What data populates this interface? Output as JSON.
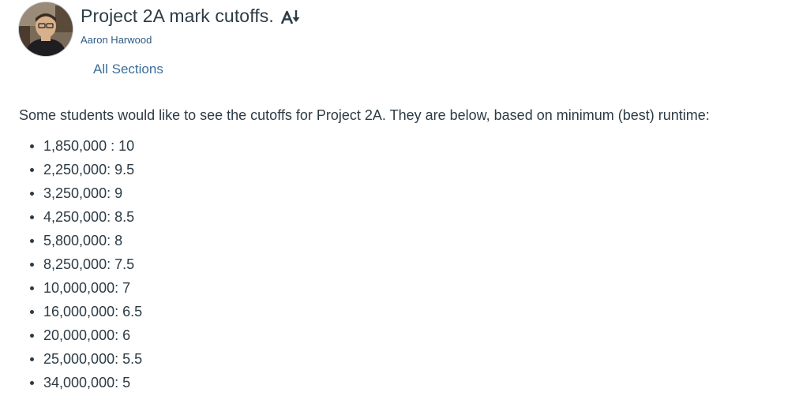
{
  "topic": {
    "title": "Project 2A mark cutoffs.",
    "translate_icon": "text-translate-icon",
    "author": "Aaron Harwood",
    "sections": "All Sections"
  },
  "message": {
    "intro": "Some students would like to see the cutoffs for Project 2A. They are below, based on minimum (best) runtime:",
    "cutoffs": [
      "1,850,000 : 10",
      "2,250,000: 9.5",
      "3,250,000: 9",
      "4,250,000: 8.5",
      "5,800,000: 8",
      "8,250,000: 7.5",
      "10,000,000: 7",
      "16,000,000: 6.5",
      "20,000,000: 6",
      "25,000,000: 5.5",
      "34,000,000: 5"
    ]
  },
  "colors": {
    "text": "#2d3b45",
    "link": "#2d5b84",
    "sections_link": "#3b6d9a"
  }
}
